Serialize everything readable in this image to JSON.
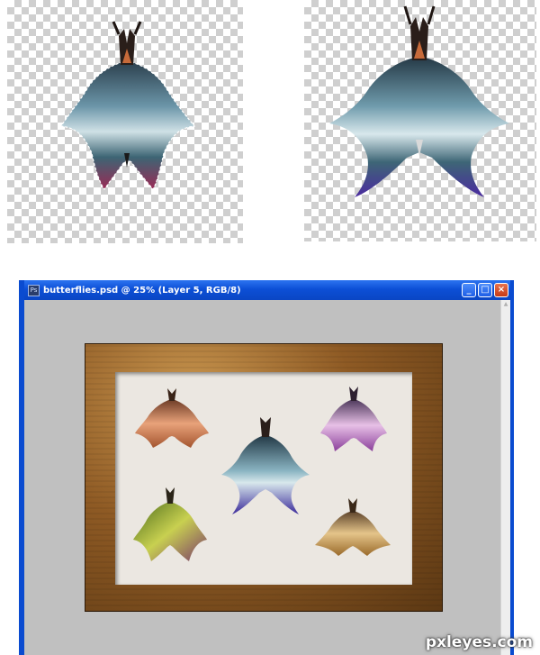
{
  "window": {
    "app_badge": "Ps",
    "title": "butterflies.psd @ 25% (Layer 5, RGB/8)",
    "minimize_glyph": "_",
    "maximize_glyph": "□",
    "close_glyph": "×"
  },
  "icons": {
    "titlebar": "photoshop-doc-icon",
    "minimize": "minimize-icon",
    "maximize": "maximize-icon",
    "close": "close-icon",
    "scroll_up": "scroll-up-arrow-icon"
  },
  "colors": {
    "titlebar_blue": "#0c4fd6",
    "canvas_gray": "#c0c0c0",
    "mat": "#ebe7e1",
    "frame_wood": "#8e5a24"
  },
  "footer": {
    "watermark": "pxleyes.com"
  }
}
